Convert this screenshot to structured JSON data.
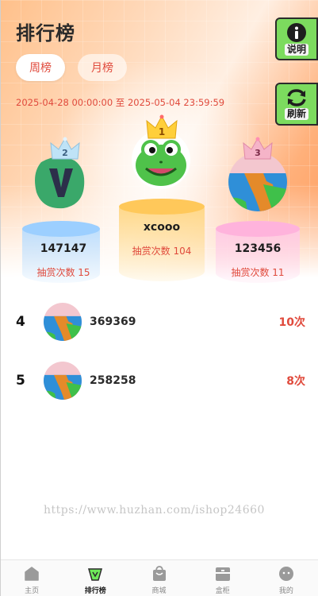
{
  "header": {
    "title": "排行榜"
  },
  "tabs": [
    {
      "label": "周榜",
      "active": true
    },
    {
      "label": "月榜",
      "active": false
    }
  ],
  "date_range": "2025-04-28 00:00:00 至 2025-05-04 23:59:59",
  "side_buttons": [
    {
      "label": "说明",
      "icon": "info-icon"
    },
    {
      "label": "刷新",
      "icon": "refresh-icon"
    }
  ],
  "podium": [
    {
      "rank": "2",
      "name": "147147",
      "count_text": "抽赏次数 15",
      "avatar": "letter-v-avatar",
      "color": "#9ccfff"
    },
    {
      "rank": "1",
      "name": "xcooo",
      "count_text": "抽赏次数 104",
      "avatar": "frog-avatar",
      "color": "#ffc85a"
    },
    {
      "rank": "3",
      "name": "123456",
      "count_text": "抽赏次数 11",
      "avatar": "coast-avatar",
      "color": "#ffb3dc"
    }
  ],
  "list": [
    {
      "rank": "4",
      "name": "369369",
      "count": "10次"
    },
    {
      "rank": "5",
      "name": "258258",
      "count": "8次"
    }
  ],
  "watermark": "https://www.huzhan.com/ishop24660",
  "tabbar": [
    {
      "label": "主页",
      "icon": "home-icon",
      "active": false
    },
    {
      "label": "排行榜",
      "icon": "ranking-icon",
      "active": true
    },
    {
      "label": "商城",
      "icon": "shop-bag-icon",
      "active": false
    },
    {
      "label": "盒柜",
      "icon": "cabinet-icon",
      "active": false
    },
    {
      "label": "我的",
      "icon": "profile-icon",
      "active": false
    }
  ],
  "colors": {
    "accent": "#e04a3c",
    "side_button": "#7cdb5e"
  }
}
